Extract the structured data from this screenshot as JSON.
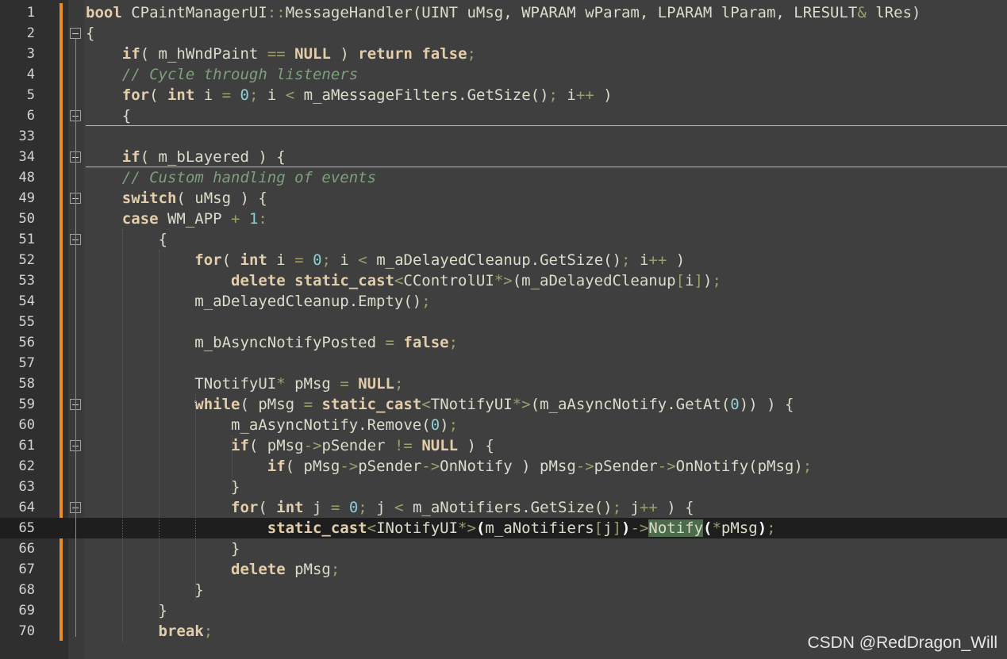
{
  "watermark": "CSDN @RedDragon_Will",
  "lines": [
    {
      "num": "1",
      "code": "bool CPaintManagerUI::MessageHandler(UINT uMsg, WPARAM wParam, LPARAM lParam, LRESULT& lRes)"
    },
    {
      "num": "2",
      "code": "{"
    },
    {
      "num": "3",
      "code": "    if( m_hWndPaint == NULL ) return false;"
    },
    {
      "num": "4",
      "code": "    // Cycle through listeners"
    },
    {
      "num": "5",
      "code": "    for( int i = 0; i < m_aMessageFilters.GetSize(); i++ )"
    },
    {
      "num": "6",
      "code": "    {"
    },
    {
      "num": "33",
      "code": ""
    },
    {
      "num": "34",
      "code": "    if( m_bLayered ) {"
    },
    {
      "num": "48",
      "code": "    // Custom handling of events"
    },
    {
      "num": "49",
      "code": "    switch( uMsg ) {"
    },
    {
      "num": "50",
      "code": "    case WM_APP + 1:"
    },
    {
      "num": "51",
      "code": "        {"
    },
    {
      "num": "52",
      "code": "            for( int i = 0; i < m_aDelayedCleanup.GetSize(); i++ )"
    },
    {
      "num": "53",
      "code": "                delete static_cast<CControlUI*>(m_aDelayedCleanup[i]);"
    },
    {
      "num": "54",
      "code": "            m_aDelayedCleanup.Empty();"
    },
    {
      "num": "55",
      "code": ""
    },
    {
      "num": "56",
      "code": "            m_bAsyncNotifyPosted = false;"
    },
    {
      "num": "57",
      "code": ""
    },
    {
      "num": "58",
      "code": "            TNotifyUI* pMsg = NULL;"
    },
    {
      "num": "59",
      "code": "            while( pMsg = static_cast<TNotifyUI*>(m_aAsyncNotify.GetAt(0)) ) {"
    },
    {
      "num": "60",
      "code": "                m_aAsyncNotify.Remove(0);"
    },
    {
      "num": "61",
      "code": "                if( pMsg->pSender != NULL ) {"
    },
    {
      "num": "62",
      "code": "                    if( pMsg->pSender->OnNotify ) pMsg->pSender->OnNotify(pMsg);"
    },
    {
      "num": "63",
      "code": "                }"
    },
    {
      "num": "64",
      "code": "                for( int j = 0; j < m_aNotifiers.GetSize(); j++ ) {"
    },
    {
      "num": "65",
      "code": "                    static_cast<INotifyUI*>(m_aNotifiers[j])->Notify(*pMsg);"
    },
    {
      "num": "66",
      "code": "                }"
    },
    {
      "num": "67",
      "code": "                delete pMsg;"
    },
    {
      "num": "68",
      "code": "            }"
    },
    {
      "num": "69",
      "code": "        }"
    },
    {
      "num": "70",
      "code": "        break;"
    }
  ]
}
